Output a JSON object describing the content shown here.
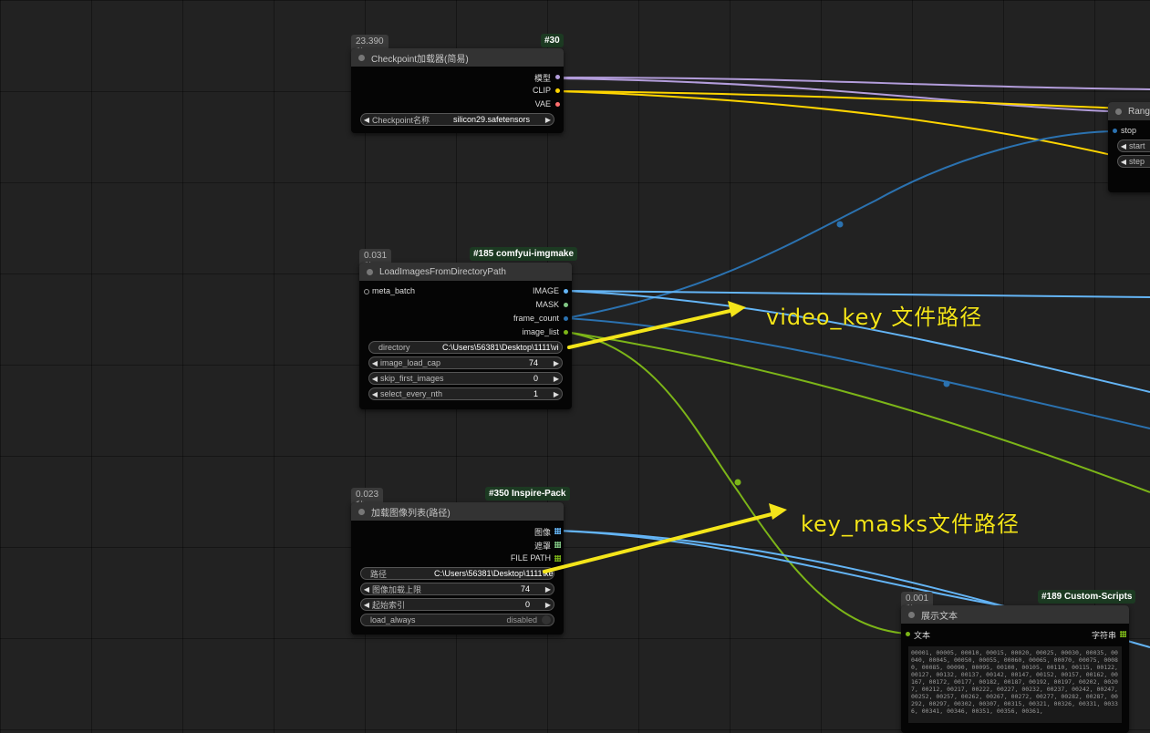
{
  "colors": {
    "model_wire": "#b39ddb",
    "clip_wire": "#ffd500",
    "vae_wire": "#ff6e6e",
    "image_wire": "#64b5f6",
    "mask_wire": "#81c784",
    "int_wire": "#2b72b0",
    "list_wire": "#7cb518",
    "annotation": "#f4e51a"
  },
  "checkpoint_node": {
    "time": "23.390秒",
    "id": "#30",
    "title": "Checkpoint加载器(简易)",
    "outputs": [
      "模型",
      "CLIP",
      "VAE"
    ],
    "widget_label": "Checkpoint名称",
    "widget_value": "silicon29.safetensors"
  },
  "load_images_node": {
    "time": "0.031秒",
    "id": "#185 comfyui-imgmake",
    "title": "LoadImagesFromDirectoryPath",
    "input": "meta_batch",
    "outputs": [
      "IMAGE",
      "MASK",
      "frame_count",
      "image_list"
    ],
    "directory_label": "directory",
    "directory_value": "C:\\Users\\56381\\Desktop\\1111\\vi",
    "image_load_cap_label": "image_load_cap",
    "image_load_cap_value": "74",
    "skip_first_images_label": "skip_first_images",
    "skip_first_images_value": "0",
    "select_every_nth_label": "select_every_nth",
    "select_every_nth_value": "1"
  },
  "inspire_node": {
    "time": "0.023秒",
    "id": "#350 Inspire-Pack",
    "title": "加载图像列表(路径)",
    "outputs": [
      "图像",
      "遮罩",
      "FILE PATH"
    ],
    "path_label": "路径",
    "path_value": "C:\\Users\\56381\\Desktop\\1111\\ke",
    "cap_label": "图像加载上限",
    "cap_value": "74",
    "start_label": "起始索引",
    "start_value": "0",
    "load_always_label": "load_always",
    "load_always_value": "disabled"
  },
  "range_node": {
    "title": "Rang",
    "input": "stop",
    "widget_start": "start",
    "widget_step": "step"
  },
  "show_text_node": {
    "time": "0.001秒",
    "id": "#189 Custom-Scripts",
    "title": "展示文本",
    "input": "文本",
    "output": "字符串",
    "content": "00001, 00005, 00010, 00015, 00020, 00025, 00030, 00035, 00040, 00045, 00050, 00055, 00060, 00065, 00070, 00075, 00080, 00085, 00090, 00095, 00100, 00105, 00110, 00115, 00122, 00127, 00132, 00137, 00142, 00147, 00152, 00157, 00162, 00167, 00172, 00177, 00182, 00187, 00192, 00197, 00202, 00207, 00212, 00217, 00222, 00227, 00232, 00237, 00242, 00247, 00252, 00257, 00262, 00267, 00272, 00277, 00282, 00287, 00292, 00297, 00302, 00307, 00315, 00321, 00326, 00331, 00336, 00341, 00346, 00351, 00356, 00361,"
  },
  "annotations": {
    "video_key": "video_key 文件路径",
    "key_masks": "key_masks文件路径"
  }
}
